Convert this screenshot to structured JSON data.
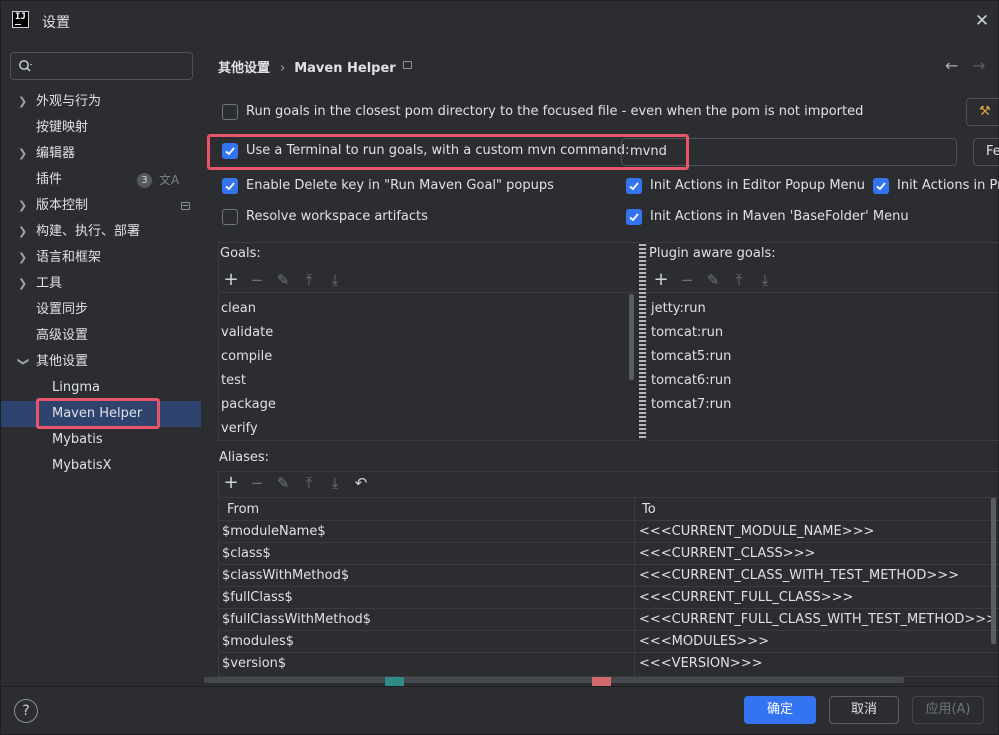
{
  "window": {
    "title": "设置",
    "close_icon": "close-icon"
  },
  "search": {
    "placeholder": ""
  },
  "sidebar": {
    "items": [
      {
        "label": "外观与行为",
        "expandable": true
      },
      {
        "label": "按键映射",
        "expandable": false
      },
      {
        "label": "编辑器",
        "expandable": true
      },
      {
        "label": "插件",
        "expandable": false,
        "badge": "3"
      },
      {
        "label": "版本控制",
        "expandable": true
      },
      {
        "label": "构建、执行、部署",
        "expandable": true
      },
      {
        "label": "语言和框架",
        "expandable": true
      },
      {
        "label": "工具",
        "expandable": true
      },
      {
        "label": "设置同步",
        "expandable": false
      },
      {
        "label": "高级设置",
        "expandable": false
      },
      {
        "label": "其他设置",
        "expandable": true,
        "expanded": true
      },
      {
        "label": "Lingma",
        "sub": true
      },
      {
        "label": "Maven Helper",
        "sub": true,
        "selected": true
      },
      {
        "label": "Mybatis",
        "sub": true
      },
      {
        "label": "MybatisX",
        "sub": true
      }
    ]
  },
  "breadcrumb": {
    "parent": "其他设置",
    "separator": "›",
    "current": "Maven Helper"
  },
  "options": {
    "closest_pom": {
      "label": "Run goals in the closest pom directory to the focused file - even when the pom is not imported",
      "checked": false
    },
    "use_terminal": {
      "label": "Use a Terminal to run goals, with a custom mvn command:",
      "checked": true,
      "value": "mvnd"
    },
    "delete_key": {
      "label": "Enable Delete key in \"Run Maven Goal\" popups",
      "checked": true
    },
    "resolve_ws": {
      "label": "Resolve workspace artifacts",
      "checked": false
    },
    "init_editor": {
      "label": "Init Actions in Editor Popup Menu",
      "checked": true
    },
    "init_project": {
      "label": "Init Actions in Pr",
      "checked": true
    },
    "init_basefolder": {
      "label": "Init Actions in Maven 'BaseFolder' Menu",
      "checked": true
    },
    "right_button": "Fe"
  },
  "goals": {
    "title": "Goals:",
    "items": [
      "clean",
      "validate",
      "compile",
      "test",
      "package",
      "verify"
    ]
  },
  "plugin_goals": {
    "title": "Plugin aware goals:",
    "items": [
      "jetty:run",
      "tomcat:run",
      "tomcat5:run",
      "tomcat6:run",
      "tomcat7:run"
    ]
  },
  "aliases": {
    "title": "Aliases:",
    "headers": {
      "from": "From",
      "to": "To"
    },
    "rows": [
      {
        "from": "$moduleName$",
        "to": "<<<CURRENT_MODULE_NAME>>>"
      },
      {
        "from": "$class$",
        "to": "<<<CURRENT_CLASS>>>"
      },
      {
        "from": "$classWithMethod$",
        "to": "<<<CURRENT_CLASS_WITH_TEST_METHOD>>>"
      },
      {
        "from": "$fullClass$",
        "to": "<<<CURRENT_FULL_CLASS>>>"
      },
      {
        "from": "$fullClassWithMethod$",
        "to": "<<<CURRENT_FULL_CLASS_WITH_TEST_METHOD>>>"
      },
      {
        "from": "$modules$",
        "to": "<<<MODULES>>>"
      },
      {
        "from": "$version$",
        "to": "<<<VERSION>>>"
      }
    ]
  },
  "colors": {
    "accent": "#3574f0",
    "highlight": "#e8556a",
    "swatch_teal": "#2e8b87",
    "swatch_red": "#d16a6a"
  },
  "footer": {
    "help": "?",
    "ok": "确定",
    "cancel": "取消",
    "apply": "应用(A)"
  }
}
